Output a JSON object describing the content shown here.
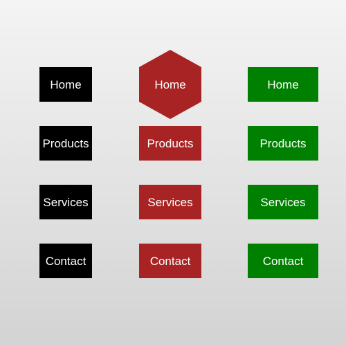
{
  "colors": {
    "black_column": "#000000",
    "red_column": "#a82424",
    "green_column": "#008000",
    "text": "#ffffff"
  },
  "menus": {
    "black": {
      "items": [
        "Home",
        "Products",
        "Services",
        "Contact"
      ]
    },
    "red": {
      "items": [
        "Home",
        "Products",
        "Services",
        "Contact"
      ],
      "active_shape": "hexagon"
    },
    "green": {
      "items": [
        "Home",
        "Products",
        "Services",
        "Contact"
      ]
    }
  }
}
